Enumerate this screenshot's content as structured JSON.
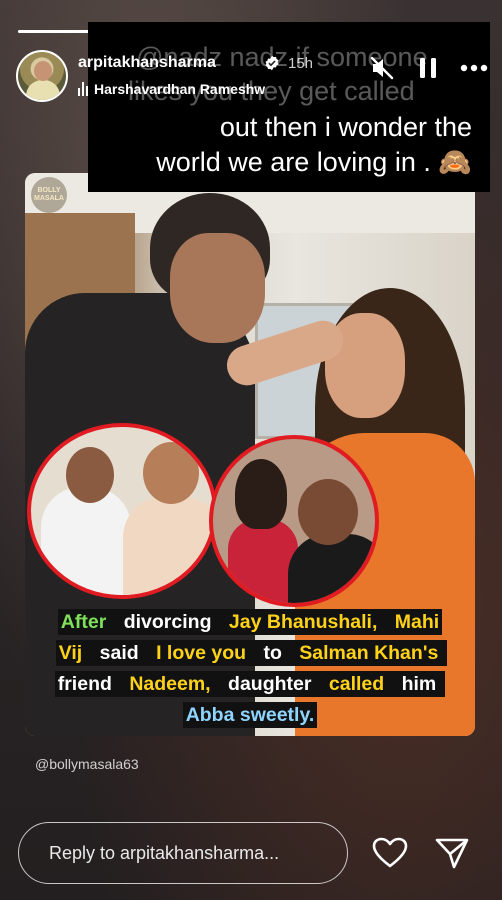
{
  "story": {
    "progress_fraction": 0.45
  },
  "header": {
    "username": "arpitakhansharma",
    "time": "15h",
    "music_label": "Harshavardhan Rameshw"
  },
  "overlay": {
    "ghost_text": "@nadz nadz if someone",
    "ghost_text2": "likes you they get called",
    "text_line1": "out then i wonder the",
    "text_line2": "world we are loving in .",
    "emoji": "🙈"
  },
  "post": {
    "badge": "BOLLY MASALA",
    "caption": {
      "s1": "After",
      "s2": "divorcing",
      "s3": "Jay Bhanushali,",
      "s4": "Mahi Vij",
      "s5": "said",
      "s6": "I love you",
      "s7": "to",
      "s8": "Salman Khan's",
      "s9": "friend",
      "s10": "Nadeem,",
      "s11": "daughter",
      "s12": "called",
      "s13": "him",
      "s14": "Abba sweetly."
    }
  },
  "mention": "@bollymasala63",
  "reply": {
    "placeholder": "Reply to arpitakhansharma..."
  }
}
